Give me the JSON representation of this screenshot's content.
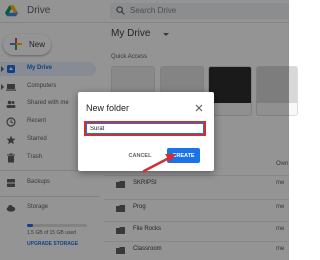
{
  "header": {
    "brand": "Drive",
    "search_placeholder": "Search Drive"
  },
  "sidebar": {
    "new_label": "New",
    "items": [
      {
        "label": "My Drive",
        "active": true
      },
      {
        "label": "Computers"
      },
      {
        "label": "Shared with me"
      },
      {
        "label": "Recent"
      },
      {
        "label": "Starred"
      },
      {
        "label": "Trash"
      },
      {
        "label": "Backups"
      }
    ],
    "storage": {
      "label": "Storage",
      "usage_text": "1.5 GB of 15 GB used",
      "used_fraction": 0.1,
      "upgrade_label": "UPGRADE STORAGE"
    }
  },
  "main": {
    "breadcrumb": "My Drive",
    "quick_access_title": "Quick Access",
    "owner_header": "Own",
    "rows": [
      {
        "name": "SKRIPSI",
        "owner": "me"
      },
      {
        "name": "Prog",
        "owner": "me"
      },
      {
        "name": "File Rocks",
        "owner": "me"
      },
      {
        "name": "Classroom",
        "owner": "me"
      }
    ]
  },
  "dialog": {
    "title": "New folder",
    "input_value": "Surat",
    "cancel_label": "CANCEL",
    "create_label": "CREATE"
  },
  "colors": {
    "accent": "#1a73e8",
    "highlight": "#d32f2f",
    "overlay": "#000000"
  }
}
